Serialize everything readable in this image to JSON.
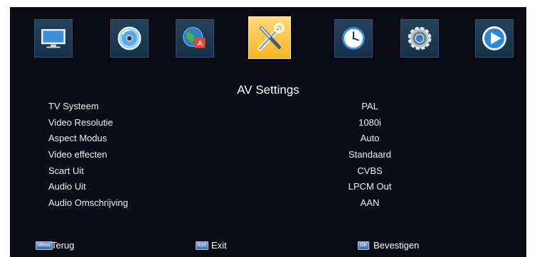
{
  "menu_icons": [
    {
      "name": "tv-icon",
      "active": false
    },
    {
      "name": "disc-icon",
      "active": false
    },
    {
      "name": "language-icon",
      "active": false
    },
    {
      "name": "tools-icon",
      "active": true
    },
    {
      "name": "clock-icon",
      "active": false
    },
    {
      "name": "gear-icon",
      "active": false
    },
    {
      "name": "play-icon",
      "active": false
    }
  ],
  "title": "AV Settings",
  "settings": [
    {
      "label": "TV Systeem",
      "value": "PAL"
    },
    {
      "label": "Video Resolutie",
      "value": "1080i"
    },
    {
      "label": "Aspect Modus",
      "value": "Auto"
    },
    {
      "label": "Video effecten",
      "value": "Standaard"
    },
    {
      "label": "Scart Uit",
      "value": "CVBS"
    },
    {
      "label": "Audio Uit",
      "value": "LPCM Out"
    },
    {
      "label": "Audio Omschrijving",
      "value": "AAN"
    }
  ],
  "footer": {
    "menu_key": "Menu",
    "back_label": "Terug",
    "exit_key": "Exit",
    "exit_label": "Exit",
    "ok_key": "OK",
    "confirm_label": "Bevestigen"
  },
  "colors": {
    "background": "#0a0b14",
    "tile": "#1f3a55",
    "active_tile": "#f5b522",
    "text": "#f0f0f0"
  }
}
